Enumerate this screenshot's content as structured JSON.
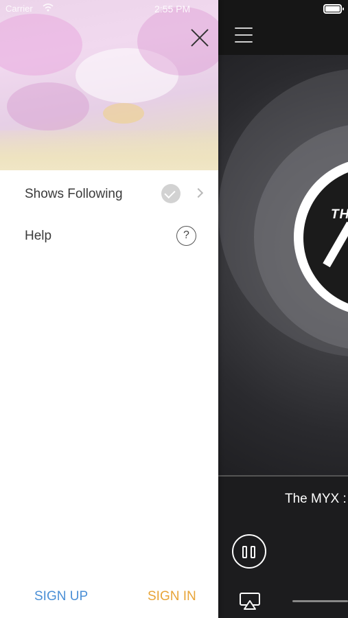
{
  "status_bar": {
    "carrier": "Carrier",
    "time": "2:55 PM"
  },
  "drawer": {
    "close_icon": "close-icon",
    "menu": [
      {
        "label": "Shows Following",
        "icon": "check-circle-icon",
        "trailing_icon": "chevron-right-icon"
      },
      {
        "label": "Help",
        "icon": "question-circle-icon",
        "icon_glyph": "?"
      }
    ],
    "sign_up_label": "SIGN UP",
    "sign_in_label": "SIGN IN"
  },
  "player": {
    "menu_icon": "hamburger-menu-icon",
    "logo_text": "TH",
    "now_playing_title": "The MYX :",
    "pause_icon": "pause-icon",
    "airplay_icon": "airplay-icon"
  },
  "colors": {
    "sign_up": "#4a8fd6",
    "sign_in": "#e8a437",
    "player_bg": "#1c1c1e"
  }
}
